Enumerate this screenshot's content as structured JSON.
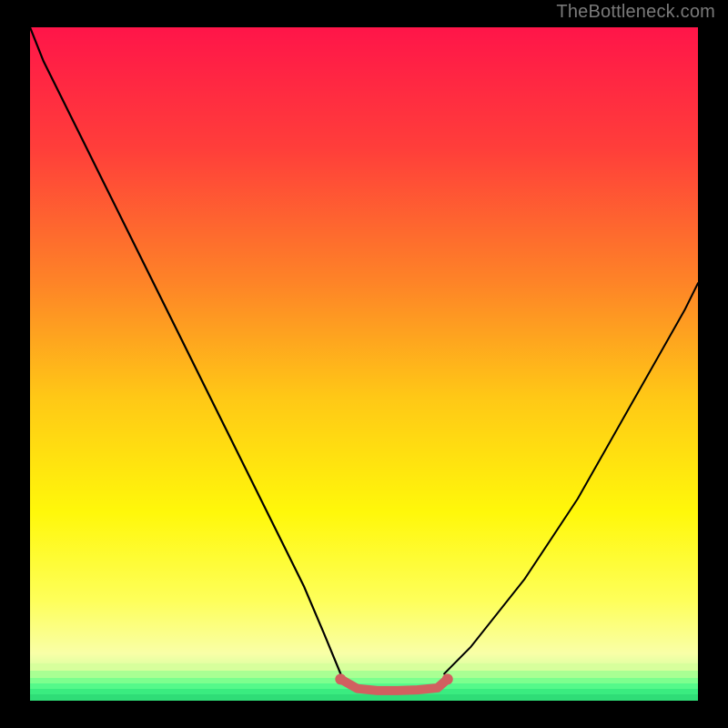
{
  "watermark": "TheBottleneck.com",
  "chart_data": {
    "type": "line",
    "title": "",
    "xlabel": "",
    "ylabel": "",
    "xlim": [
      0,
      100
    ],
    "ylim": [
      0,
      100
    ],
    "background_gradient": {
      "stops": [
        {
          "pos": 0.0,
          "color": "#ff1549"
        },
        {
          "pos": 0.18,
          "color": "#ff3e3a"
        },
        {
          "pos": 0.38,
          "color": "#fe8427"
        },
        {
          "pos": 0.55,
          "color": "#ffc816"
        },
        {
          "pos": 0.72,
          "color": "#fff80a"
        },
        {
          "pos": 0.85,
          "color": "#feff59"
        },
        {
          "pos": 0.93,
          "color": "#f9ffa7"
        },
        {
          "pos": 0.965,
          "color": "#c6ff9d"
        },
        {
          "pos": 0.985,
          "color": "#62ff8f"
        },
        {
          "pos": 1.0,
          "color": "#2ee67a"
        }
      ]
    },
    "series": [
      {
        "name": "curve-left",
        "color": "#000000",
        "width": 2.2,
        "x": [
          0,
          2,
          5,
          8,
          11,
          14,
          17,
          20,
          23,
          26,
          29,
          32,
          35,
          38,
          41,
          44,
          46.5
        ],
        "y": [
          100,
          95,
          89,
          83,
          77,
          71,
          65,
          59,
          53,
          47,
          41,
          35,
          29,
          23,
          17,
          10,
          4
        ]
      },
      {
        "name": "curve-right",
        "color": "#000000",
        "width": 2.0,
        "x": [
          62,
          66,
          70,
          74,
          78,
          82,
          86,
          90,
          94,
          98,
          100
        ],
        "y": [
          4,
          8,
          13,
          18,
          24,
          30,
          37,
          44,
          51,
          58,
          62
        ]
      },
      {
        "name": "bottom-marker",
        "color": "#d16060",
        "width": 10,
        "x": [
          46.5,
          49,
          52,
          55,
          58,
          61,
          62.5
        ],
        "y": [
          3.2,
          1.8,
          1.5,
          1.5,
          1.6,
          1.9,
          3.2
        ]
      }
    ],
    "green_bands_y": [
      94.5,
      95.6,
      96.6,
      97.4,
      98.2,
      99.0
    ]
  }
}
